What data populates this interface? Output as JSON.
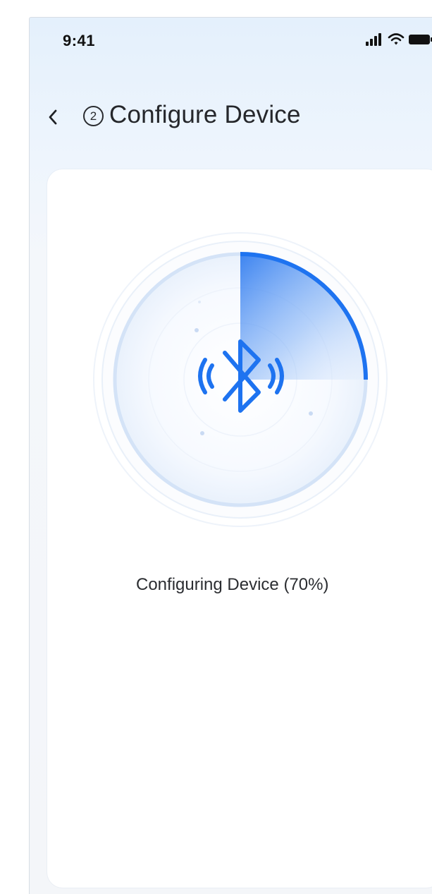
{
  "status_bar": {
    "time": "9:41",
    "icons": [
      "cellular-signal-icon",
      "wifi-icon",
      "battery-icon"
    ]
  },
  "header": {
    "back_icon": "chevron-left-icon",
    "step_number": "2",
    "title": "Configure Device"
  },
  "progress": {
    "icon": "bluetooth-icon",
    "label": "Configuring Device (70%)",
    "fraction_filled": 0.25
  },
  "colors": {
    "accent": "#1e73f0",
    "ring": "#d7e5f8",
    "background_top": "#e4f0fc",
    "card": "#ffffff"
  }
}
